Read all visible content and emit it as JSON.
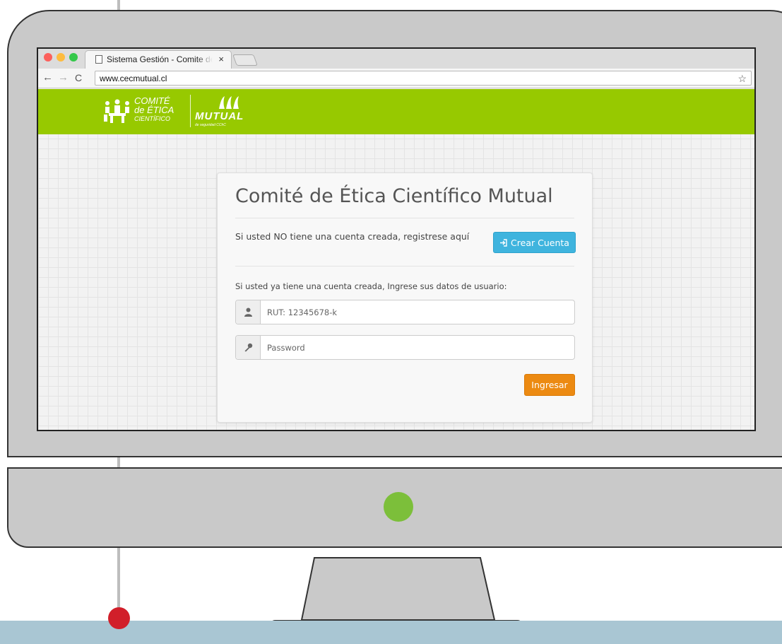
{
  "browser": {
    "tab_title": "Sistema Gestión - Comite de Ética",
    "tab_close": "×",
    "url": "www.cecmutual.cl"
  },
  "header": {
    "logo_cec_line1": "COMITÉ",
    "logo_cec_line2": "de ÉTICA",
    "logo_cec_line3": "CIENTÍFICO",
    "logo_mutual_word": "MUTUAL",
    "logo_mutual_sub": "de seguridad CChC"
  },
  "login": {
    "title": "Comité de Ética Científico Mutual",
    "register_prompt": "Si usted NO tiene una cuenta creada, registrese aquí",
    "create_account_label": "Crear Cuenta",
    "login_prompt": "Si usted ya tiene una cuenta creada, Ingrese sus datos de usuario:",
    "rut_placeholder": "RUT: 12345678-k",
    "password_placeholder": "Password",
    "submit_label": "Ingresar"
  },
  "colors": {
    "header_green": "#97c900",
    "create_button": "#3fb4de",
    "submit_button": "#ec8a12",
    "power_led": "#7cbf3a",
    "timeline_dot": "#d11f2a"
  }
}
